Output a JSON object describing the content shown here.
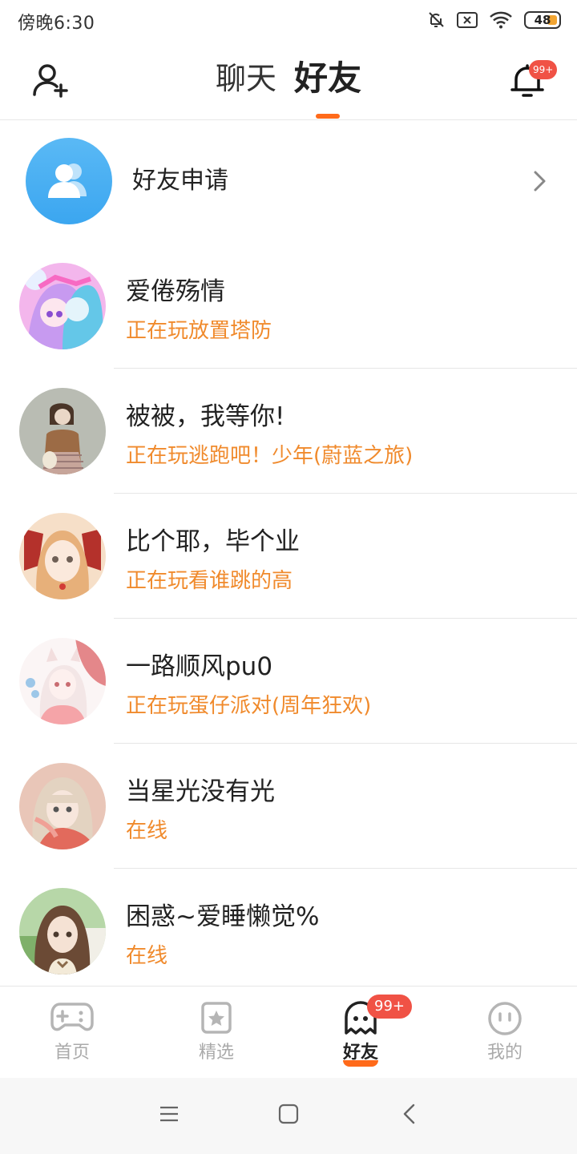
{
  "status_bar": {
    "time": "傍晚6:30",
    "battery_level": "48",
    "icons": [
      "bell-muted-icon",
      "sim-x-icon",
      "wifi-icon",
      "battery-icon"
    ]
  },
  "header": {
    "tabs": [
      {
        "label": "聊天",
        "active": false
      },
      {
        "label": "好友",
        "active": true
      }
    ],
    "notification_badge": "99+",
    "left_icon": "add-user-icon",
    "right_icon": "bell-icon"
  },
  "friend_request": {
    "label": "好友申请"
  },
  "friends": [
    {
      "name": "爱倦殇情",
      "status": "正在玩放置塔防"
    },
    {
      "name": "被被，我等你!",
      "status": "正在玩逃跑吧！少年(蔚蓝之旅)"
    },
    {
      "name": "比个耶，毕个业",
      "status": "正在玩看谁跳的高"
    },
    {
      "name": "一路顺风pu0",
      "status": "正在玩蛋仔派对(周年狂欢)"
    },
    {
      "name": "当星光没有光",
      "status": "在线"
    },
    {
      "name": "困惑~爱睡懒觉%",
      "status": "在线"
    }
  ],
  "bottom_nav": {
    "items": [
      {
        "label": "首页",
        "icon": "gamepad-icon",
        "active": false
      },
      {
        "label": "精选",
        "icon": "star-card-icon",
        "active": false
      },
      {
        "label": "好友",
        "icon": "ghost-icon",
        "active": true
      },
      {
        "label": "我的",
        "icon": "face-icon",
        "active": false
      }
    ],
    "badge": "99+"
  },
  "colors": {
    "accent": "#ff6a1a",
    "status_text": "#f08a2c",
    "badge": "#f05245",
    "request_avatar": "#4aaef2"
  }
}
